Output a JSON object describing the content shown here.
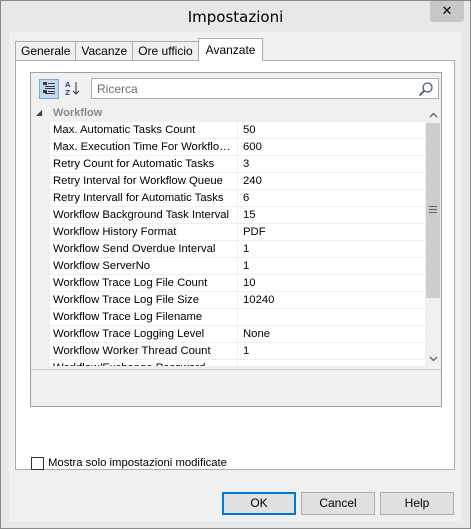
{
  "window": {
    "title": "Impostazioni",
    "close_glyph": "✕"
  },
  "tabs": [
    {
      "label": "Generale",
      "active": false
    },
    {
      "label": "Vacanze",
      "active": false
    },
    {
      "label": "Ore ufficio",
      "active": false
    },
    {
      "label": "Avanzate",
      "active": true
    }
  ],
  "toolbar": {
    "categorized_icon": "categorized-view-icon",
    "alphabetical_icon": "sort-alphabetical-icon",
    "search_placeholder": "Ricerca",
    "search_icon": "search-icon"
  },
  "grid": {
    "category": "Workflow",
    "rows": [
      {
        "name": "Max. Automatic Tasks Count",
        "value": "50"
      },
      {
        "name": "Max. Execution Time For Workflow ...",
        "value": "600"
      },
      {
        "name": "Retry Count for Automatic Tasks",
        "value": "3"
      },
      {
        "name": "Retry Interval for Workflow Queue",
        "value": "240"
      },
      {
        "name": "Retry Intervall for Automatic Tasks",
        "value": "6"
      },
      {
        "name": "Workflow Background Task Interval",
        "value": "15"
      },
      {
        "name": "Workflow History Format",
        "value": "PDF"
      },
      {
        "name": "Workflow Send Overdue Interval",
        "value": "1"
      },
      {
        "name": "Workflow ServerNo",
        "value": "1"
      },
      {
        "name": "Workflow Trace Log File Count",
        "value": "10"
      },
      {
        "name": "Workflow Trace Log File Size",
        "value": "10240"
      },
      {
        "name": "Workflow Trace Log Filename",
        "value": ""
      },
      {
        "name": "Workflow Trace Logging Level",
        "value": "None"
      },
      {
        "name": "Workflow Worker Thread Count",
        "value": "1"
      },
      {
        "name": "Workflow/Exchange Password",
        "value": ""
      }
    ]
  },
  "filter": {
    "label": "Mostra solo impostazioni modificate",
    "checked": false
  },
  "buttons": {
    "ok": "OK",
    "cancel": "Cancel",
    "help": "Help"
  }
}
